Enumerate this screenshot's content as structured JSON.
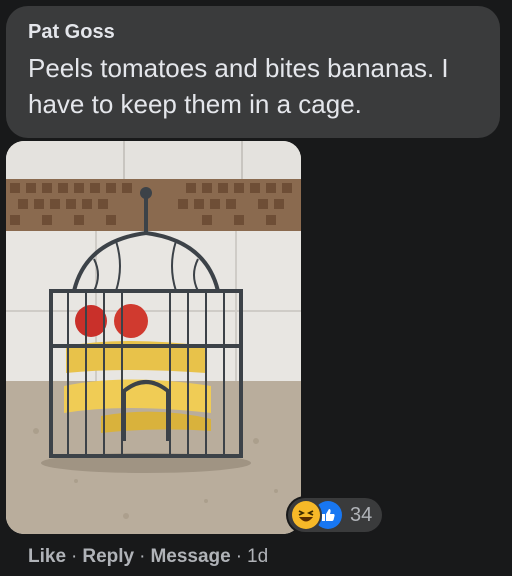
{
  "comment": {
    "author": "Pat Goss",
    "text": "Peels tomatoes and bites bananas. I have to keep them in a cage."
  },
  "reactions": {
    "icons": [
      "haha-icon",
      "like-icon"
    ],
    "count": "34"
  },
  "actions": {
    "like": "Like",
    "reply": "Reply",
    "message": "Message",
    "separator": "·",
    "time": "1d"
  },
  "colors": {
    "background": "#18191a",
    "bubble": "#3a3b3c",
    "text_primary": "#e4e6eb",
    "text_secondary": "#b0b3b8",
    "like_blue": "#1877f2",
    "haha_yellow": "#f7b928"
  }
}
